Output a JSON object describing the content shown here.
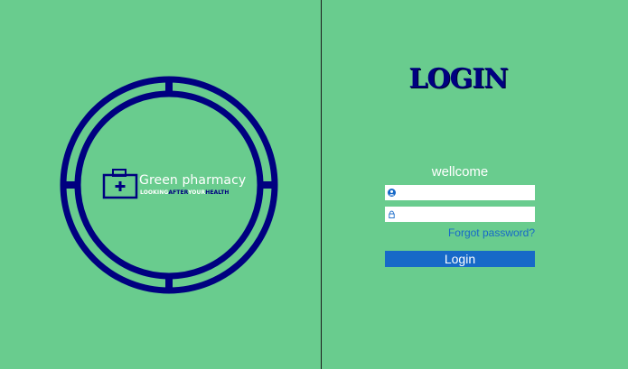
{
  "brand": {
    "name": "Green pharmacy",
    "tagline": {
      "part1": "LOOKING",
      "part2": "AFTER",
      "part3": "YOUR",
      "part4": "HEALTH"
    }
  },
  "login_form": {
    "heading": "LOGIN",
    "welcome": "wellcome",
    "username": {
      "value": "",
      "placeholder": "",
      "icon": "user-icon"
    },
    "password": {
      "value": "",
      "placeholder": "",
      "icon": "lock-icon"
    },
    "forgot_label": "Forgot password?",
    "submit_label": "Login"
  },
  "colors": {
    "background": "#69cc8e",
    "ring": "#000080",
    "button": "#1769c8",
    "link": "#1769c8"
  }
}
